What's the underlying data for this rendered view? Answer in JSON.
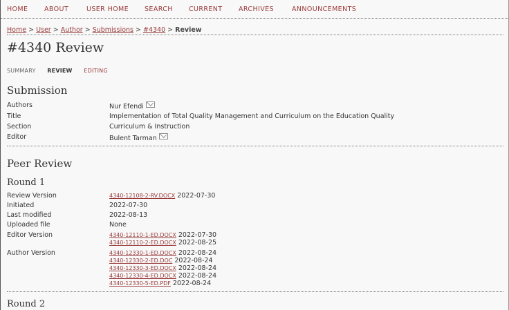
{
  "nav": [
    "HOME",
    "ABOUT",
    "USER HOME",
    "SEARCH",
    "CURRENT",
    "ARCHIVES",
    "ANNOUNCEMENTS"
  ],
  "breadcrumb": {
    "home": "Home",
    "user": "User",
    "author": "Author",
    "submissions": "Submissions",
    "id": "#4340",
    "current": "Review",
    "sep": " > "
  },
  "page_title": "#4340 Review",
  "subtabs": {
    "summary": "SUMMARY",
    "review": "REVIEW",
    "editing": "EDITING"
  },
  "submission": {
    "heading": "Submission",
    "authors_label": "Authors",
    "authors_value": "Nur Efendi",
    "title_label": "Title",
    "title_value": "Implementation of Total Quality Management and Curriculum on the Education Quality",
    "section_label": "Section",
    "section_value": "Curriculum & Instruction",
    "editor_label": "Editor",
    "editor_value": "Bulent Tarman"
  },
  "peer_review": {
    "heading": "Peer Review",
    "round1": {
      "heading": "Round 1",
      "review_version_label": "Review Version",
      "review_version_file": "4340-12108-2-RV.DOCX",
      "review_version_date": "2022-07-30",
      "initiated_label": "Initiated",
      "initiated_value": "2022-07-30",
      "last_modified_label": "Last modified",
      "last_modified_value": "2022-08-13",
      "uploaded_label": "Uploaded file",
      "uploaded_value": "None",
      "editor_version_label": "Editor Version",
      "editor_files": [
        {
          "file": "4340-12110-1-ED.DOCX",
          "date": "2022-07-30"
        },
        {
          "file": "4340-12110-2-ED.DOCX",
          "date": "2022-08-25"
        }
      ],
      "author_version_label": "Author Version",
      "author_files": [
        {
          "file": "4340-12330-1-ED.DOCX",
          "date": "2022-08-24"
        },
        {
          "file": "4340-12330-2-ED.DOC",
          "date": "2022-08-24"
        },
        {
          "file": "4340-12330-3-ED.DOCX",
          "date": "2022-08-24"
        },
        {
          "file": "4340-12330-4-ED.DOCX",
          "date": "2022-08-24"
        },
        {
          "file": "4340-12330-5-ED.PDF",
          "date": "2022-08-24"
        }
      ]
    },
    "round2": {
      "heading": "Round 2"
    }
  }
}
